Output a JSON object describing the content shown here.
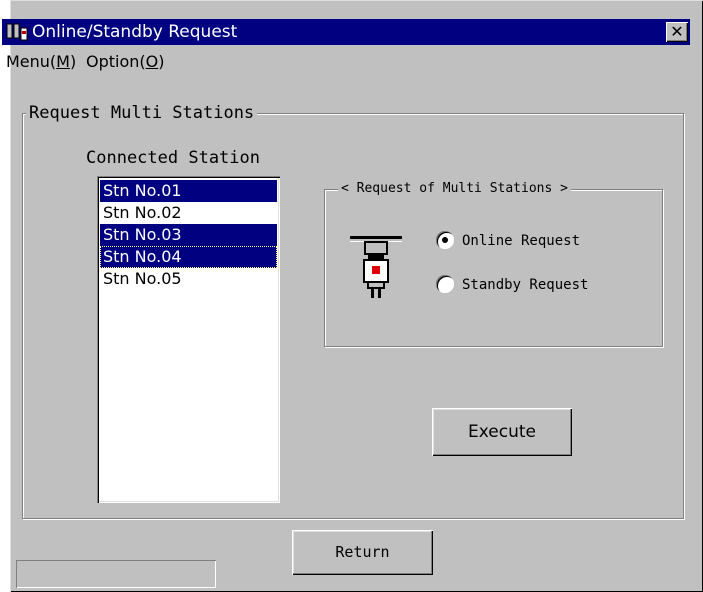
{
  "window": {
    "title": "Online/Standby Request",
    "close_label": "✕"
  },
  "menu": {
    "items": [
      "Menu(M)",
      "Option(O)"
    ],
    "menu_prefix": "Menu(",
    "menu_key": "M",
    "option_prefix": "Option(",
    "option_key": "O",
    "suffix": ")"
  },
  "group": {
    "title": "Request Multi Stations"
  },
  "stations": {
    "label": "Connected Station",
    "items": [
      "Stn No.01",
      "Stn No.02",
      "Stn No.03",
      "Stn No.04",
      "Stn No.05"
    ],
    "selected": [
      true,
      false,
      true,
      true,
      false
    ]
  },
  "request": {
    "title": "< Request of Multi Stations >",
    "options": [
      {
        "label": "Online Request",
        "checked": true
      },
      {
        "label": "Standby Request",
        "checked": false
      }
    ]
  },
  "buttons": {
    "execute": "Execute",
    "return": "Return"
  },
  "colors": {
    "selection": "#000080",
    "face": "#c0c0c0",
    "title_bar": "#000080"
  }
}
